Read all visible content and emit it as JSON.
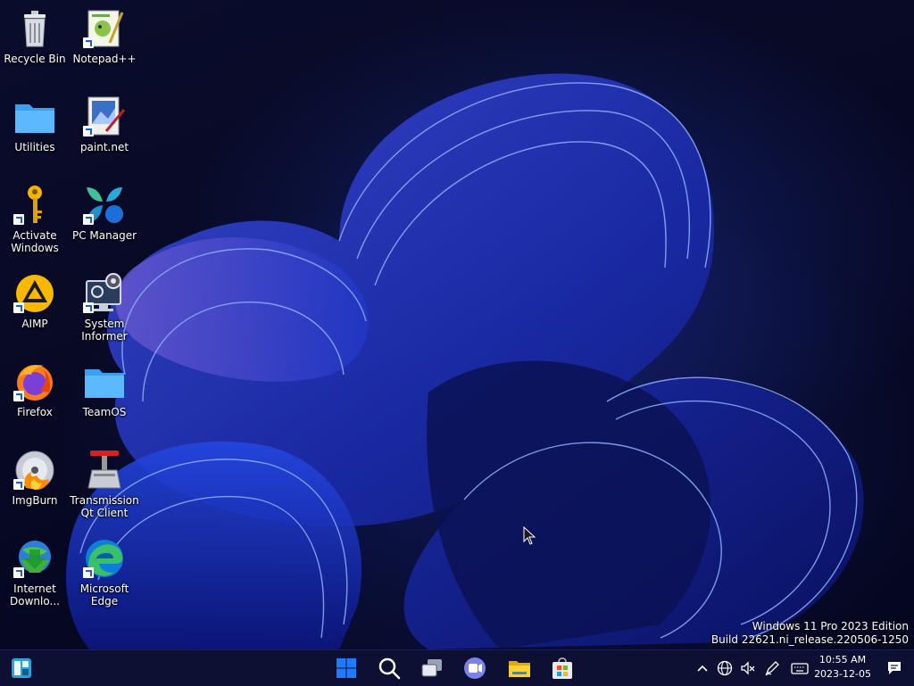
{
  "desktop_icons": [
    {
      "label": "Recycle Bin",
      "icon": "recycle-bin-icon"
    },
    {
      "label": "Notepad++",
      "icon": "notepadpp-icon"
    },
    {
      "label": "Utilities",
      "icon": "folder-icon"
    },
    {
      "label": "paint.net",
      "icon": "paintnet-icon"
    },
    {
      "label": "Activate\nWindows",
      "icon": "key-icon"
    },
    {
      "label": "PC Manager",
      "icon": "pc-manager-icon"
    },
    {
      "label": "AIMP",
      "icon": "aimp-icon"
    },
    {
      "label": "System\nInformer",
      "icon": "system-informer-icon"
    },
    {
      "label": "Firefox",
      "icon": "firefox-icon"
    },
    {
      "label": "TeamOS",
      "icon": "folder-icon"
    },
    {
      "label": "ImgBurn",
      "icon": "imgburn-icon"
    },
    {
      "label": "Transmission\nQt Client",
      "icon": "transmission-icon"
    },
    {
      "label": "Internet\nDownlo...",
      "icon": "idm-icon"
    },
    {
      "label": "Microsoft\nEdge",
      "icon": "edge-icon"
    }
  ],
  "watermark": {
    "line1": "Windows 11 Pro 2023 Edition",
    "line2": "Build 22621.ni_release.220506-1250"
  },
  "taskbar": {
    "widgets": "widgets-icon",
    "pinned": [
      "start-icon",
      "search-icon",
      "task-view-icon",
      "teams-icon",
      "file-explorer-icon",
      "store-icon"
    ],
    "tray": [
      "chevron-up-icon",
      "network-icon",
      "volume-muted-icon",
      "pen-icon",
      "keyboard-icon"
    ],
    "clock": {
      "time": "10:55 AM",
      "date": "2023-12-05"
    },
    "notifications": "notifications-icon"
  },
  "colors": {
    "taskbar": "#0d1033",
    "accent": "#1e5bff"
  }
}
